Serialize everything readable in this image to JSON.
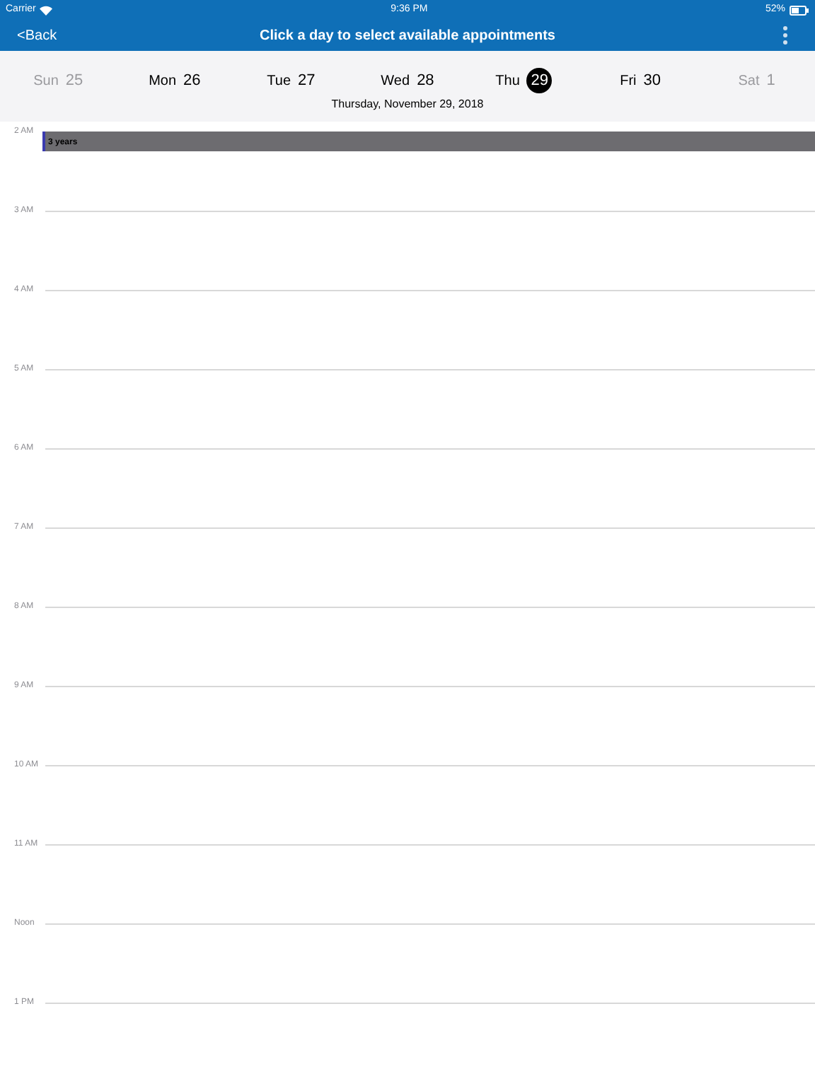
{
  "status_bar": {
    "carrier": "Carrier",
    "time": "9:36 PM",
    "battery": "52%"
  },
  "nav": {
    "back": "<Back",
    "title": "Click a day to select available appointments"
  },
  "days": [
    {
      "name": "Sun",
      "date": "25",
      "disabled": true,
      "selected": false
    },
    {
      "name": "Mon",
      "date": "26",
      "disabled": false,
      "selected": false
    },
    {
      "name": "Tue",
      "date": "27",
      "disabled": false,
      "selected": false
    },
    {
      "name": "Wed",
      "date": "28",
      "disabled": false,
      "selected": false
    },
    {
      "name": "Thu",
      "date": "29",
      "disabled": false,
      "selected": true
    },
    {
      "name": "Fri",
      "date": "30",
      "disabled": false,
      "selected": false
    },
    {
      "name": "Sat",
      "date": "1",
      "disabled": true,
      "selected": false
    }
  ],
  "selected_date": "Thursday, November 29, 2018",
  "hours": [
    {
      "label": "2 AM",
      "appointments": [
        "3 years"
      ]
    },
    {
      "label": "3 AM"
    },
    {
      "label": "4 AM"
    },
    {
      "label": "5 AM"
    },
    {
      "label": "6 AM"
    },
    {
      "label": "7 AM"
    },
    {
      "label": "8 AM"
    },
    {
      "label": "9 AM"
    },
    {
      "label": "10 AM"
    },
    {
      "label": "11 AM"
    },
    {
      "label": "Noon"
    },
    {
      "label": "1 PM"
    }
  ]
}
